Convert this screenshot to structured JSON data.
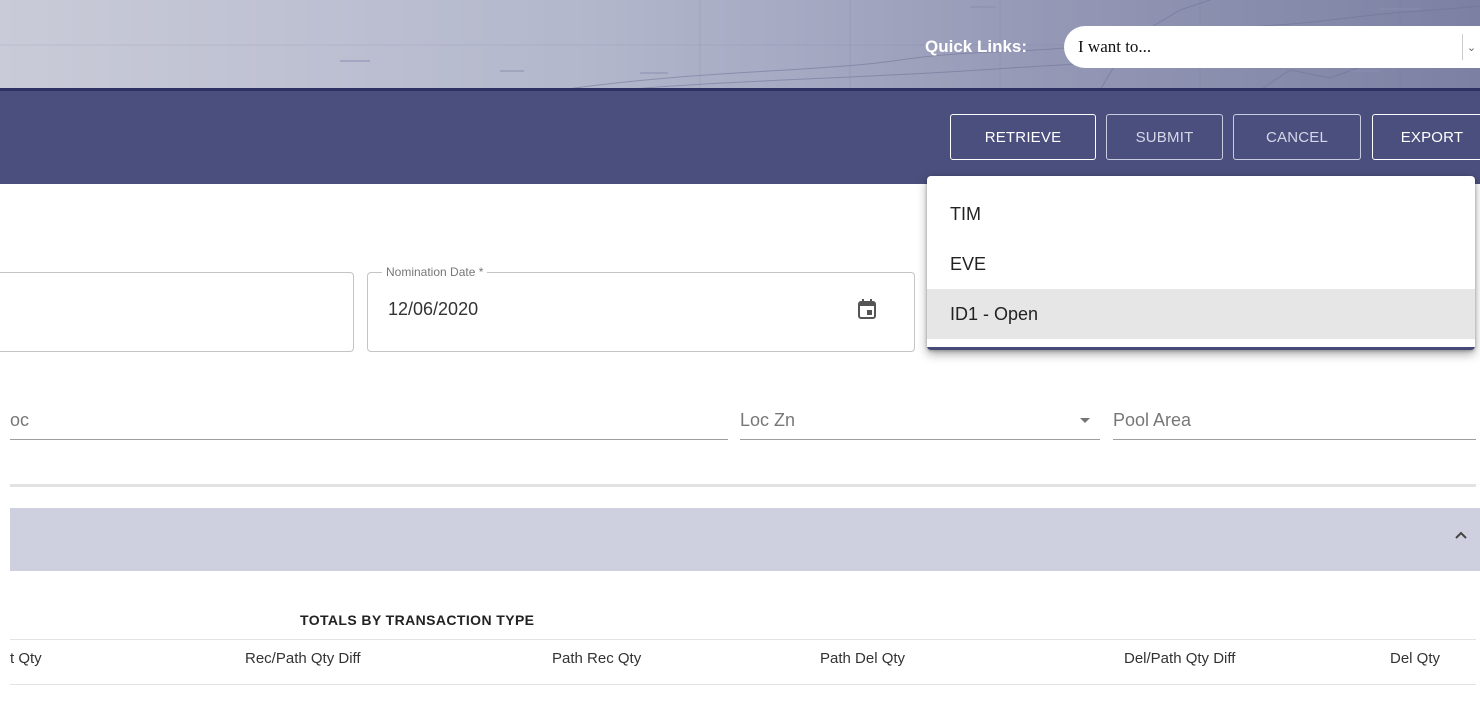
{
  "header": {
    "quick_links_label": "Quick Links:",
    "quick_links_value": "I want to..."
  },
  "toolbar": {
    "buttons": [
      {
        "label": "RETRIEVE"
      },
      {
        "label": "SUBMIT"
      },
      {
        "label": "CANCEL"
      },
      {
        "label": "EXPORT"
      }
    ]
  },
  "form": {
    "nomination_date_label": "Nomination Date *",
    "nomination_date_value": "12/06/2020",
    "loc_placeholder": "oc",
    "loc_zn_placeholder": "Loc Zn",
    "pool_area_placeholder": "Pool Area"
  },
  "dropdown": {
    "options": [
      "TIM",
      "EVE",
      "ID1 - Open"
    ],
    "selected": "ID1 - Open"
  },
  "totals": {
    "title": "TOTALS BY TRANSACTION TYPE",
    "columns": [
      "t Qty",
      "Rec/Path Qty Diff",
      "Path Rec Qty",
      "Path Del Qty",
      "Del/Path Qty Diff",
      "Del Qty"
    ]
  },
  "colors": {
    "toolbar_bg": "#4b4f7d",
    "section_bar_bg": "#cfd0df",
    "accent_dark": "#2d3263"
  }
}
